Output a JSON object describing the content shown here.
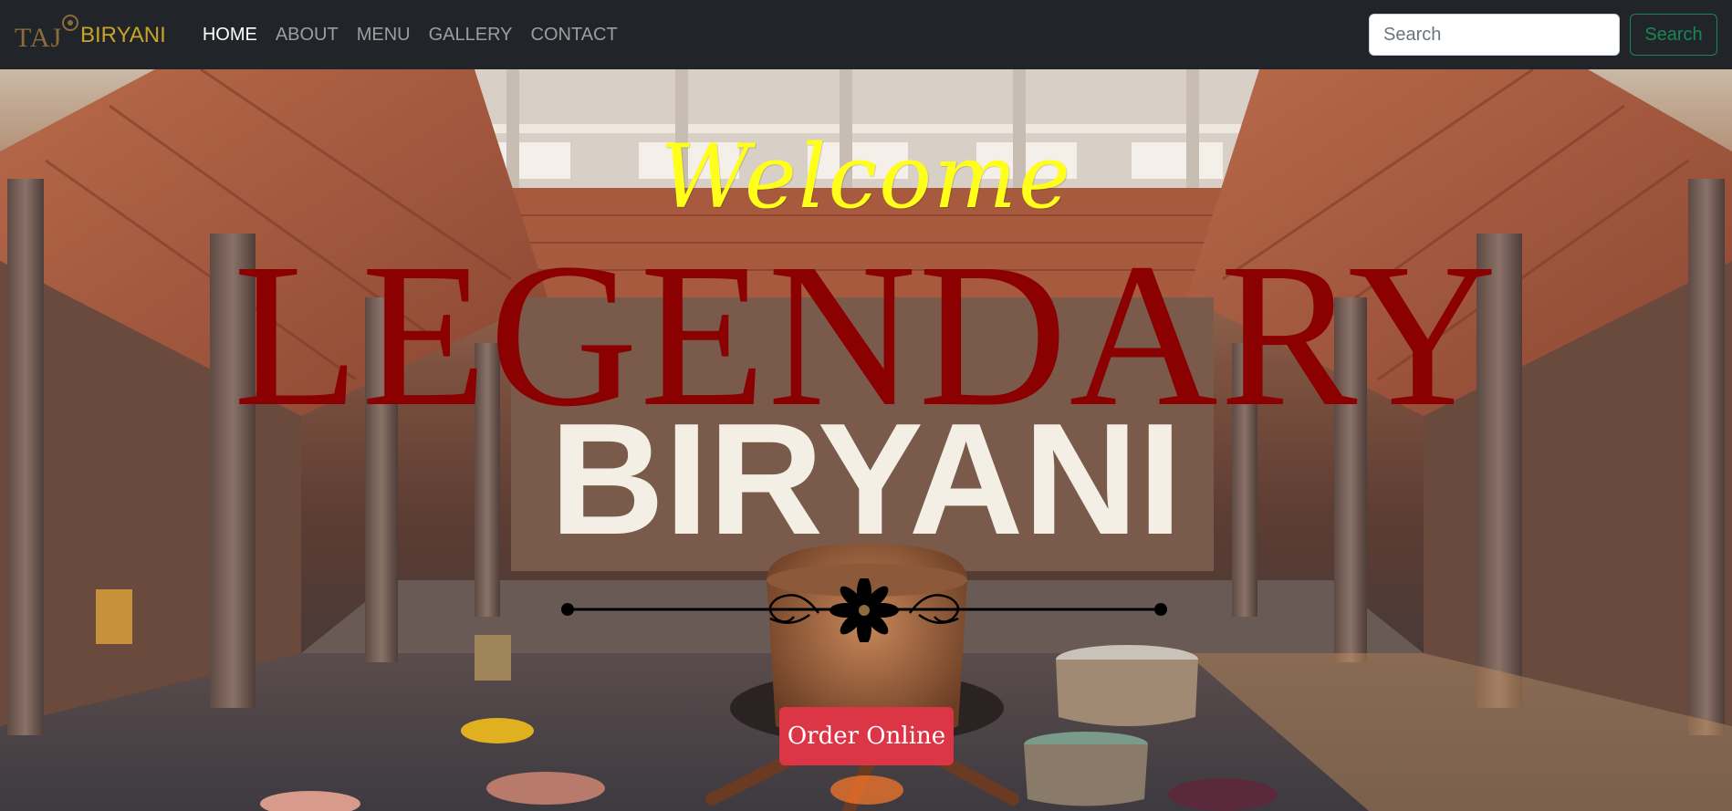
{
  "navbar": {
    "brand": {
      "mark_text": "TAJ",
      "name": "BIRYANI"
    },
    "links": [
      {
        "label": "HOME",
        "active": true
      },
      {
        "label": "ABOUT",
        "active": false
      },
      {
        "label": "MENU",
        "active": false
      },
      {
        "label": "GALLERY",
        "active": false
      },
      {
        "label": "CONTACT",
        "active": false
      }
    ],
    "search": {
      "placeholder": "Search",
      "button_label": "Search"
    }
  },
  "hero": {
    "welcome": "Welcome",
    "headline": "LEGENDARY",
    "subheadline": "BIRYANI",
    "cta_label": "Order Online"
  },
  "colors": {
    "navbar_bg": "#212529",
    "welcome": "#ffff1a",
    "headline": "#8b0000",
    "subheadline": "#f3efe5",
    "cta_bg": "#dc3545",
    "search_button": "#198754",
    "brand_name": "#c9a227"
  }
}
